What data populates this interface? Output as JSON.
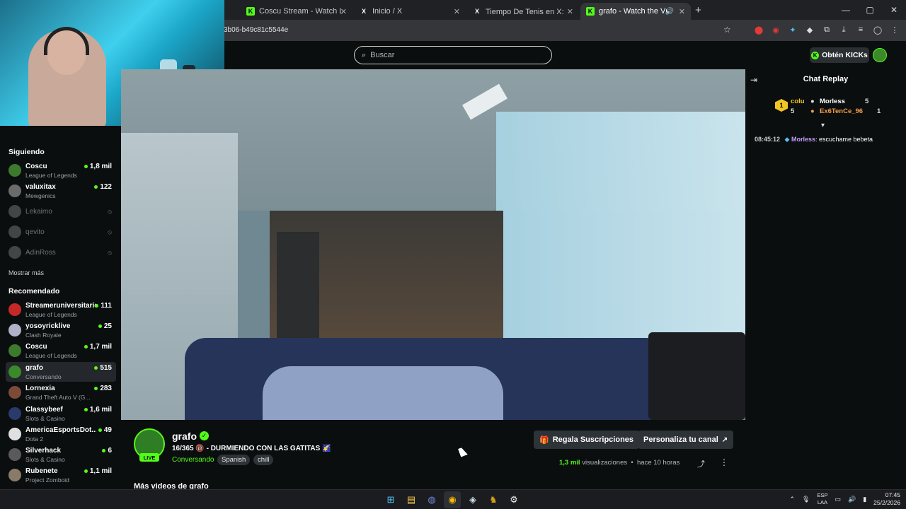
{
  "browser": {
    "tabs": [
      {
        "title": "Coscu Stream - Watch Live on K",
        "icon": "kick-favicon"
      },
      {
        "title": "Inicio / X",
        "icon": "x-favicon"
      },
      {
        "title": "Tiempo De Tenis en X: \"🦉 EL E",
        "icon": "x-favicon"
      },
      {
        "title": "grafo - Watch the VOD on K",
        "icon": "kick-favicon"
      }
    ],
    "url": "3b06-b49c81c5544e",
    "new_tab": "+",
    "window_controls": [
      "—",
      "▢",
      "✕"
    ]
  },
  "header": {
    "search_placeholder": "Buscar",
    "get_kicks": "Obtén KICKs"
  },
  "sidebar": {
    "following_title": "Siguiendo",
    "following": [
      {
        "name": "Coscu",
        "sub": "League of Legends",
        "count": "1,8 mil",
        "avatar_color": "#3c7a2e"
      },
      {
        "name": "valuxitax",
        "sub": "Mewgenics",
        "count": "122",
        "avatar_color": "#6b6b6b"
      },
      {
        "name": "Lekaimo",
        "offline": true,
        "avatar_color": "#8a8a8a"
      },
      {
        "name": "qevito",
        "offline": true,
        "avatar_color": "#8a8a8a"
      },
      {
        "name": "AdinRoss",
        "offline": true,
        "avatar_color": "#8a8a8a"
      }
    ],
    "show_more": "Mostrar más",
    "recommended_title": "Recomendado",
    "recommended": [
      {
        "name": "Streameruniversitario",
        "sub": "League of Legends",
        "count": "111",
        "avatar_color": "#c62828"
      },
      {
        "name": "yosoyricklive",
        "sub": "Clash Royale",
        "count": "25",
        "avatar_color": "#b0b0c8"
      },
      {
        "name": "Coscu",
        "sub": "League of Legends",
        "count": "1,7 mil",
        "avatar_color": "#3c7a2e"
      },
      {
        "name": "grafo",
        "sub": "Conversando",
        "count": "515",
        "avatar_color": "#3a8a2a",
        "active": true
      },
      {
        "name": "Lornexia",
        "sub": "Grand Theft Auto V (G...",
        "count": "283",
        "avatar_color": "#7d4a3a"
      },
      {
        "name": "Classybeef",
        "sub": "Slots & Casino",
        "count": "1,6 mil",
        "avatar_color": "#2a3a6a"
      },
      {
        "name": "AmericaEsportsDot...",
        "sub": "Dota 2",
        "count": "49",
        "avatar_color": "#e0e0e0"
      },
      {
        "name": "Silverhack",
        "sub": "Slots & Casino",
        "count": "6",
        "avatar_color": "#5a5a5a"
      },
      {
        "name": "Rubenete",
        "sub": "Project Zomboid",
        "count": "1,1 mil",
        "avatar_color": "#8a7a6a"
      }
    ]
  },
  "channel": {
    "name": "grafo",
    "live_badge": "LIVE",
    "title": "16/365 🔞 - DURMIENDO CON LAS GATITAS 🌠",
    "category": "Conversando",
    "tags": [
      "Spanish",
      "chill"
    ],
    "gift_button": "Regala Suscripciones",
    "customize_button": "Personaliza tu canal",
    "views_count": "1,3 mil",
    "views_label": "visualizaciones",
    "time_ago": "hace 10 horas",
    "more_videos": "Más videos de grafo"
  },
  "chat": {
    "title": "Chat Replay",
    "leaderboard": [
      {
        "rank": "1",
        "name": "colu",
        "count": "5"
      },
      {
        "name": "Morless",
        "count": "5"
      },
      {
        "name": "Ex6TenCe_96",
        "count": "1"
      }
    ],
    "messages": [
      {
        "time": "08:45:12",
        "user": "Morless",
        "text": ": escuchame bebeta"
      }
    ]
  },
  "taskbar": {
    "lang_top": "ESP",
    "lang_bottom": "LAA",
    "time": "07:45",
    "date": "25/2/2026"
  },
  "colors": {
    "accent": "#53fc18",
    "bg": "#0b0e0f",
    "panel": "#2e3338"
  }
}
